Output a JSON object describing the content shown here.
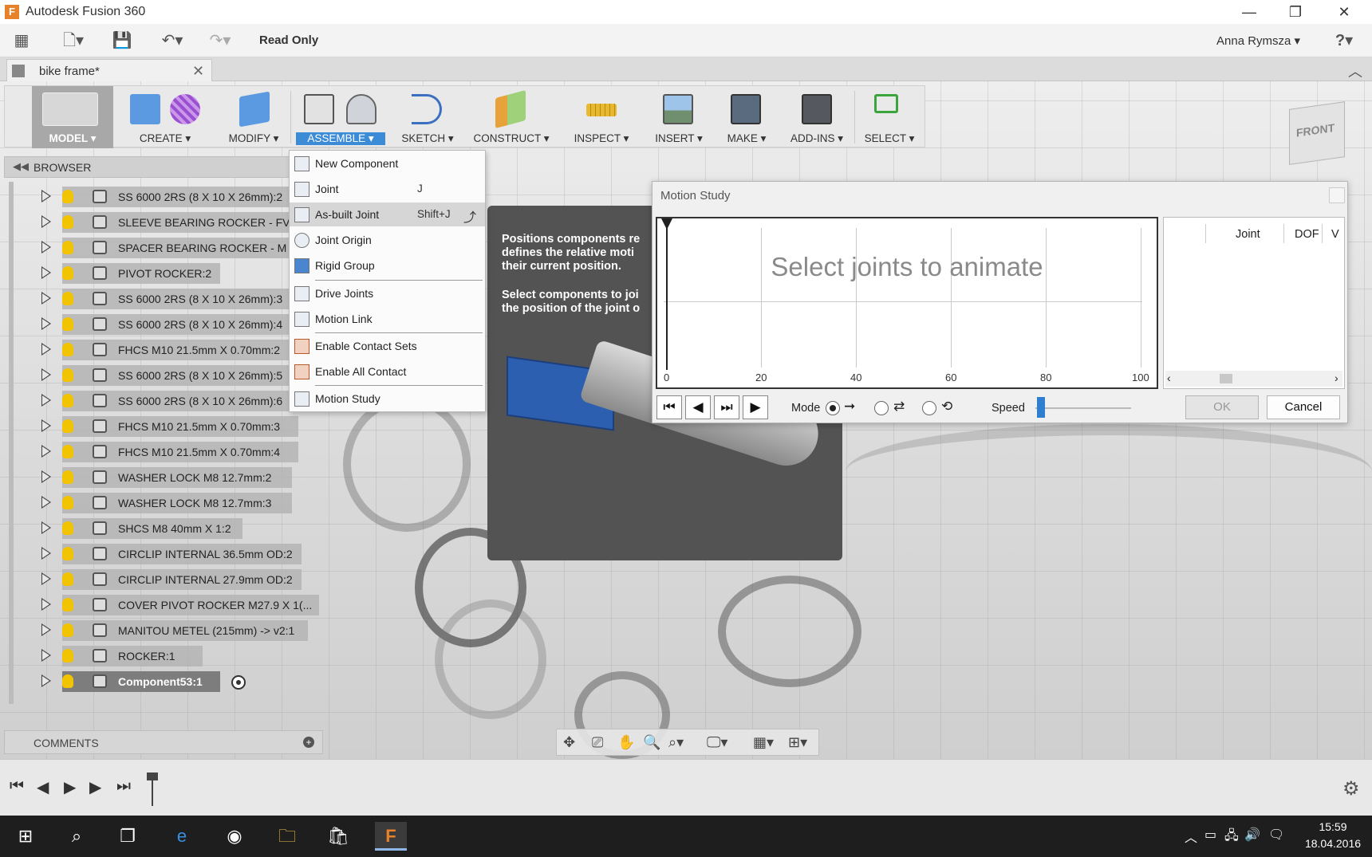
{
  "window": {
    "title": "Autodesk Fusion 360",
    "logo_letter": "F"
  },
  "toolbar": {
    "read_only": "Read Only",
    "user": "Anna Rymsza ▾",
    "help": "?"
  },
  "tab": {
    "name": "bike frame*"
  },
  "ribbon": {
    "groups": [
      {
        "label": "MODEL ▾"
      },
      {
        "label": "CREATE ▾"
      },
      {
        "label": "MODIFY ▾"
      },
      {
        "label": "ASSEMBLE ▾"
      },
      {
        "label": "SKETCH ▾"
      },
      {
        "label": "CONSTRUCT ▾"
      },
      {
        "label": "INSPECT ▾"
      },
      {
        "label": "INSERT ▾"
      },
      {
        "label": "MAKE ▾"
      },
      {
        "label": "ADD-INS ▾"
      },
      {
        "label": "SELECT ▾"
      }
    ]
  },
  "viewcube": {
    "label": "FRONT"
  },
  "browser": {
    "title": "BROWSER",
    "items": [
      {
        "label": "SS 6000 2RS (8 X 10 X 26mm):2"
      },
      {
        "label": "SLEEVE BEARING ROCKER - FV"
      },
      {
        "label": "SPACER BEARING ROCKER - M"
      },
      {
        "label": "PIVOT ROCKER:2"
      },
      {
        "label": "SS 6000 2RS (8 X 10 X 26mm):3"
      },
      {
        "label": "SS 6000 2RS (8 X 10 X 26mm):4"
      },
      {
        "label": "FHCS M10 21.5mm X 0.70mm:2"
      },
      {
        "label": "SS 6000 2RS (8 X 10 X 26mm):5"
      },
      {
        "label": "SS 6000 2RS (8 X 10 X 26mm):6"
      },
      {
        "label": "FHCS M10 21.5mm X 0.70mm:3"
      },
      {
        "label": "FHCS M10 21.5mm X 0.70mm:4"
      },
      {
        "label": "WASHER LOCK M8 12.7mm:2"
      },
      {
        "label": "WASHER LOCK M8 12.7mm:3"
      },
      {
        "label": "SHCS M8 40mm X 1:2"
      },
      {
        "label": "CIRCLIP INTERNAL 36.5mm OD:2"
      },
      {
        "label": "CIRCLIP INTERNAL 27.9mm OD:2"
      },
      {
        "label": "COVER PIVOT ROCKER M27.9 X 1(..."
      },
      {
        "label": "MANITOU METEL (215mm) -> v2:1"
      },
      {
        "label": "ROCKER:1"
      },
      {
        "label": "Component53:1"
      }
    ]
  },
  "comments": {
    "title": "COMMENTS"
  },
  "assemble_menu": {
    "items": [
      {
        "label": "New Component",
        "shortcut": ""
      },
      {
        "label": "Joint",
        "shortcut": "J"
      },
      {
        "label": "As-built Joint",
        "shortcut": "Shift+J"
      },
      {
        "label": "Joint Origin",
        "shortcut": ""
      },
      {
        "label": "Rigid Group",
        "shortcut": ""
      },
      {
        "label": "Drive Joints",
        "shortcut": ""
      },
      {
        "label": "Motion Link",
        "shortcut": ""
      },
      {
        "label": "Enable Contact Sets",
        "shortcut": ""
      },
      {
        "label": "Enable All Contact",
        "shortcut": ""
      },
      {
        "label": "Motion Study",
        "shortcut": ""
      }
    ]
  },
  "tooltip": {
    "line1": "Positions components re\ndefines the relative moti\ntheir current position.",
    "line2": "Select components to joi\nthe position of the joint o"
  },
  "motion_study": {
    "title": "Motion Study",
    "hint": "Select joints to animate",
    "ticks": [
      "0",
      "20",
      "40",
      "60",
      "80",
      "100"
    ],
    "columns": [
      "Joint",
      "DOF",
      "V"
    ],
    "mode_label": "Mode",
    "speed_label": "Speed",
    "ok": "OK",
    "cancel": "Cancel"
  },
  "taskbar": {
    "time": "15:59",
    "date": "18.04.2016"
  },
  "colors": {
    "accent": "#3b8bd6",
    "tooltip_bg": "#535353"
  }
}
